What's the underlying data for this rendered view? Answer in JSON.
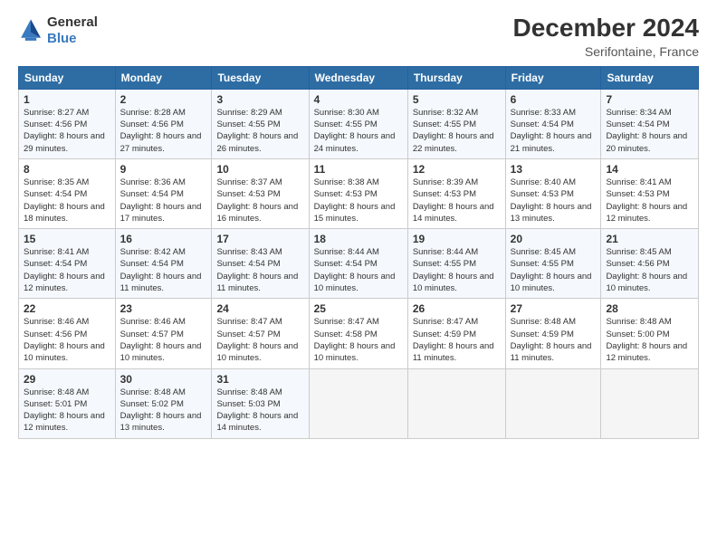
{
  "logo": {
    "general": "General",
    "blue": "Blue"
  },
  "title": "December 2024",
  "subtitle": "Serifontaine, France",
  "days_header": [
    "Sunday",
    "Monday",
    "Tuesday",
    "Wednesday",
    "Thursday",
    "Friday",
    "Saturday"
  ],
  "weeks": [
    [
      {
        "day": "1",
        "sunrise": "8:27 AM",
        "sunset": "4:56 PM",
        "daylight": "8 hours and 29 minutes."
      },
      {
        "day": "2",
        "sunrise": "8:28 AM",
        "sunset": "4:56 PM",
        "daylight": "8 hours and 27 minutes."
      },
      {
        "day": "3",
        "sunrise": "8:29 AM",
        "sunset": "4:55 PM",
        "daylight": "8 hours and 26 minutes."
      },
      {
        "day": "4",
        "sunrise": "8:30 AM",
        "sunset": "4:55 PM",
        "daylight": "8 hours and 24 minutes."
      },
      {
        "day": "5",
        "sunrise": "8:32 AM",
        "sunset": "4:55 PM",
        "daylight": "8 hours and 22 minutes."
      },
      {
        "day": "6",
        "sunrise": "8:33 AM",
        "sunset": "4:54 PM",
        "daylight": "8 hours and 21 minutes."
      },
      {
        "day": "7",
        "sunrise": "8:34 AM",
        "sunset": "4:54 PM",
        "daylight": "8 hours and 20 minutes."
      }
    ],
    [
      {
        "day": "8",
        "sunrise": "8:35 AM",
        "sunset": "4:54 PM",
        "daylight": "8 hours and 18 minutes."
      },
      {
        "day": "9",
        "sunrise": "8:36 AM",
        "sunset": "4:54 PM",
        "daylight": "8 hours and 17 minutes."
      },
      {
        "day": "10",
        "sunrise": "8:37 AM",
        "sunset": "4:53 PM",
        "daylight": "8 hours and 16 minutes."
      },
      {
        "day": "11",
        "sunrise": "8:38 AM",
        "sunset": "4:53 PM",
        "daylight": "8 hours and 15 minutes."
      },
      {
        "day": "12",
        "sunrise": "8:39 AM",
        "sunset": "4:53 PM",
        "daylight": "8 hours and 14 minutes."
      },
      {
        "day": "13",
        "sunrise": "8:40 AM",
        "sunset": "4:53 PM",
        "daylight": "8 hours and 13 minutes."
      },
      {
        "day": "14",
        "sunrise": "8:41 AM",
        "sunset": "4:53 PM",
        "daylight": "8 hours and 12 minutes."
      }
    ],
    [
      {
        "day": "15",
        "sunrise": "8:41 AM",
        "sunset": "4:54 PM",
        "daylight": "8 hours and 12 minutes."
      },
      {
        "day": "16",
        "sunrise": "8:42 AM",
        "sunset": "4:54 PM",
        "daylight": "8 hours and 11 minutes."
      },
      {
        "day": "17",
        "sunrise": "8:43 AM",
        "sunset": "4:54 PM",
        "daylight": "8 hours and 11 minutes."
      },
      {
        "day": "18",
        "sunrise": "8:44 AM",
        "sunset": "4:54 PM",
        "daylight": "8 hours and 10 minutes."
      },
      {
        "day": "19",
        "sunrise": "8:44 AM",
        "sunset": "4:55 PM",
        "daylight": "8 hours and 10 minutes."
      },
      {
        "day": "20",
        "sunrise": "8:45 AM",
        "sunset": "4:55 PM",
        "daylight": "8 hours and 10 minutes."
      },
      {
        "day": "21",
        "sunrise": "8:45 AM",
        "sunset": "4:56 PM",
        "daylight": "8 hours and 10 minutes."
      }
    ],
    [
      {
        "day": "22",
        "sunrise": "8:46 AM",
        "sunset": "4:56 PM",
        "daylight": "8 hours and 10 minutes."
      },
      {
        "day": "23",
        "sunrise": "8:46 AM",
        "sunset": "4:57 PM",
        "daylight": "8 hours and 10 minutes."
      },
      {
        "day": "24",
        "sunrise": "8:47 AM",
        "sunset": "4:57 PM",
        "daylight": "8 hours and 10 minutes."
      },
      {
        "day": "25",
        "sunrise": "8:47 AM",
        "sunset": "4:58 PM",
        "daylight": "8 hours and 10 minutes."
      },
      {
        "day": "26",
        "sunrise": "8:47 AM",
        "sunset": "4:59 PM",
        "daylight": "8 hours and 11 minutes."
      },
      {
        "day": "27",
        "sunrise": "8:48 AM",
        "sunset": "4:59 PM",
        "daylight": "8 hours and 11 minutes."
      },
      {
        "day": "28",
        "sunrise": "8:48 AM",
        "sunset": "5:00 PM",
        "daylight": "8 hours and 12 minutes."
      }
    ],
    [
      {
        "day": "29",
        "sunrise": "8:48 AM",
        "sunset": "5:01 PM",
        "daylight": "8 hours and 12 minutes."
      },
      {
        "day": "30",
        "sunrise": "8:48 AM",
        "sunset": "5:02 PM",
        "daylight": "8 hours and 13 minutes."
      },
      {
        "day": "31",
        "sunrise": "8:48 AM",
        "sunset": "5:03 PM",
        "daylight": "8 hours and 14 minutes."
      },
      null,
      null,
      null,
      null
    ]
  ],
  "labels": {
    "sunrise_prefix": "Sunrise: ",
    "sunset_prefix": "Sunset: ",
    "daylight_prefix": "Daylight: "
  }
}
